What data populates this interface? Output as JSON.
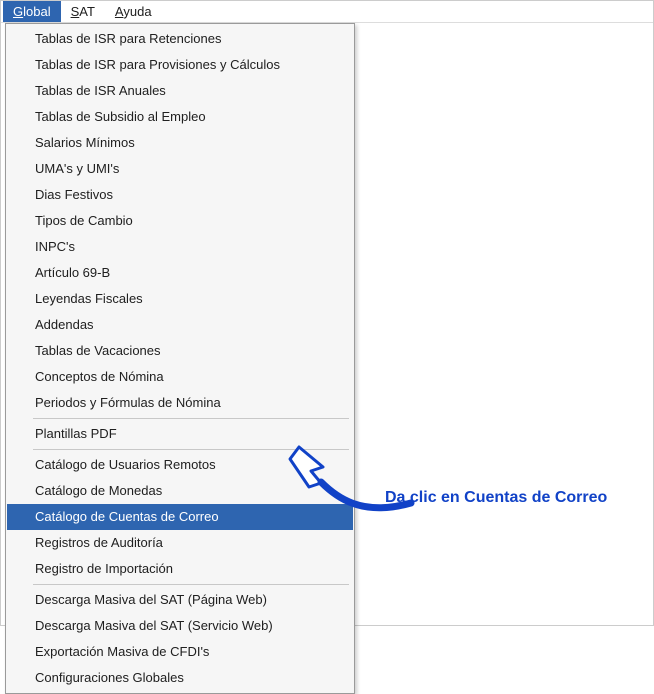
{
  "menubar": {
    "items": [
      {
        "label": "Global",
        "ul_index": 0,
        "active": true
      },
      {
        "label": "SAT",
        "ul_index": 0,
        "active": false
      },
      {
        "label": "Ayuda",
        "ul_index": 0,
        "active": false
      }
    ]
  },
  "dropdown": {
    "items": [
      {
        "label": "Tablas de ISR para Retenciones"
      },
      {
        "label": "Tablas de ISR para Provisiones y Cálculos"
      },
      {
        "label": "Tablas de ISR Anuales"
      },
      {
        "label": "Tablas de Subsidio al Empleo"
      },
      {
        "label": "Salarios Mínimos"
      },
      {
        "label": "UMA's y UMI's"
      },
      {
        "label": "Dias Festivos"
      },
      {
        "label": "Tipos de Cambio"
      },
      {
        "label": "INPC's"
      },
      {
        "label": "Artículo 69-B"
      },
      {
        "label": "Leyendas Fiscales"
      },
      {
        "label": "Addendas"
      },
      {
        "label": "Tablas de Vacaciones"
      },
      {
        "label": "Conceptos de Nómina"
      },
      {
        "label": "Periodos y Fórmulas de Nómina"
      },
      {
        "sep": true
      },
      {
        "label": "Plantillas PDF"
      },
      {
        "sep": true
      },
      {
        "label": "Catálogo de Usuarios Remotos"
      },
      {
        "label": "Catálogo de Monedas"
      },
      {
        "label": "Catálogo de Cuentas de Correo",
        "highlight": true
      },
      {
        "label": "Registros de Auditoría"
      },
      {
        "label": "Registro de Importación"
      },
      {
        "sep": true
      },
      {
        "label": "Descarga Masiva del SAT (Página Web)"
      },
      {
        "label": "Descarga Masiva del SAT (Servicio Web)"
      },
      {
        "label": "Exportación Masiva de CFDI's"
      },
      {
        "label": "Configuraciones Globales"
      }
    ]
  },
  "annotation": {
    "text": "Da clic en Cuentas de Correo"
  },
  "colors": {
    "accent": "#2e65b0",
    "arrow": "#1142c7"
  }
}
